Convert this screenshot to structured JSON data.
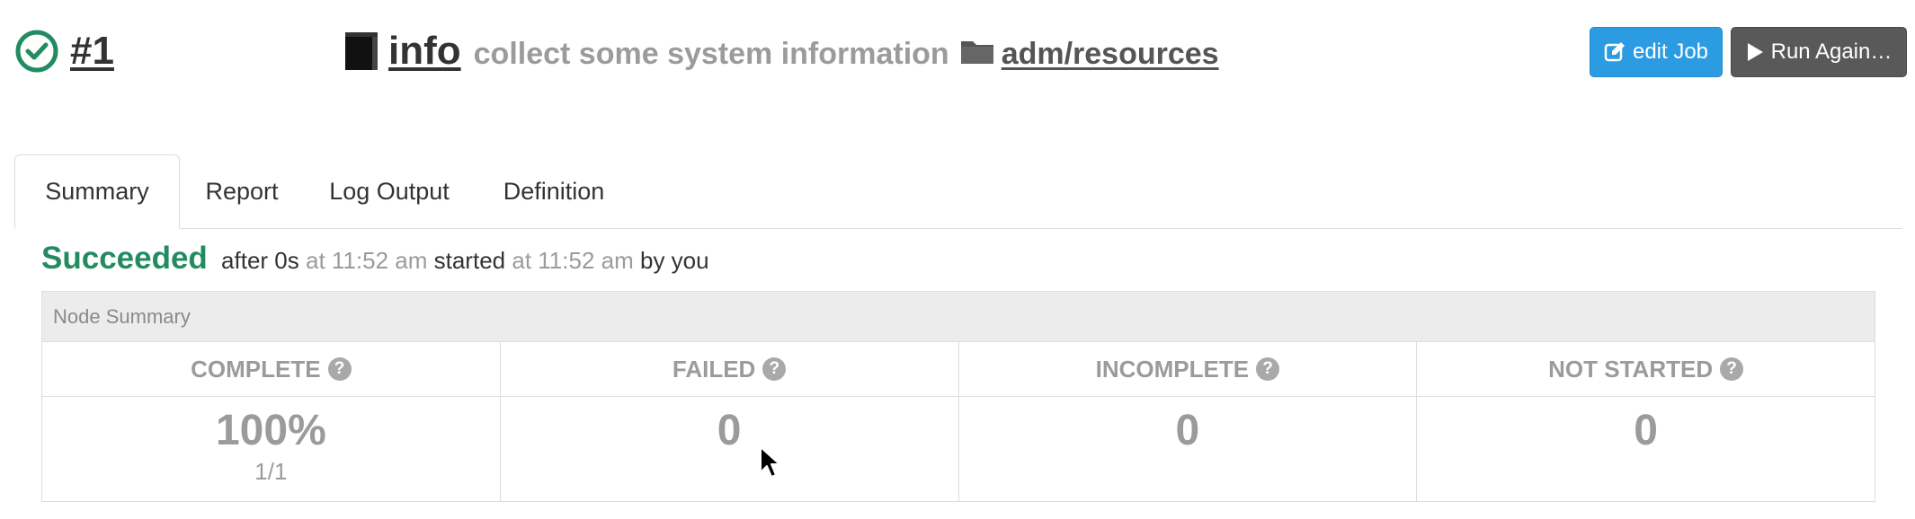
{
  "header": {
    "execution_id": "#1",
    "job_name": "info",
    "job_description": "collect some system information",
    "group_path": "adm/resources",
    "status_icon": "check-circle-icon",
    "job_icon": "book-icon",
    "group_icon": "folder-icon",
    "status_color": "#228b62"
  },
  "actions": {
    "edit_label": "edit Job",
    "run_again_label": "Run Again…",
    "edit_color": "#2b9be2",
    "run_again_color": "#595959"
  },
  "tabs": [
    {
      "label": "Summary",
      "active": true
    },
    {
      "label": "Report"
    },
    {
      "label": "Log Output"
    },
    {
      "label": "Definition"
    }
  ],
  "status_line": {
    "state": "Succeeded",
    "after": "after 0s",
    "at1": "at 11:52 am",
    "started": "started",
    "at2": "at 11:52 am",
    "by": "by you"
  },
  "node_summary": {
    "title": "Node Summary",
    "columns": [
      {
        "label": "COMPLETE",
        "value": "100%",
        "sub": "1/1"
      },
      {
        "label": "FAILED",
        "value": "0"
      },
      {
        "label": "INCOMPLETE",
        "value": "0"
      },
      {
        "label": "NOT STARTED",
        "value": "0"
      }
    ],
    "help_glyph": "?"
  }
}
